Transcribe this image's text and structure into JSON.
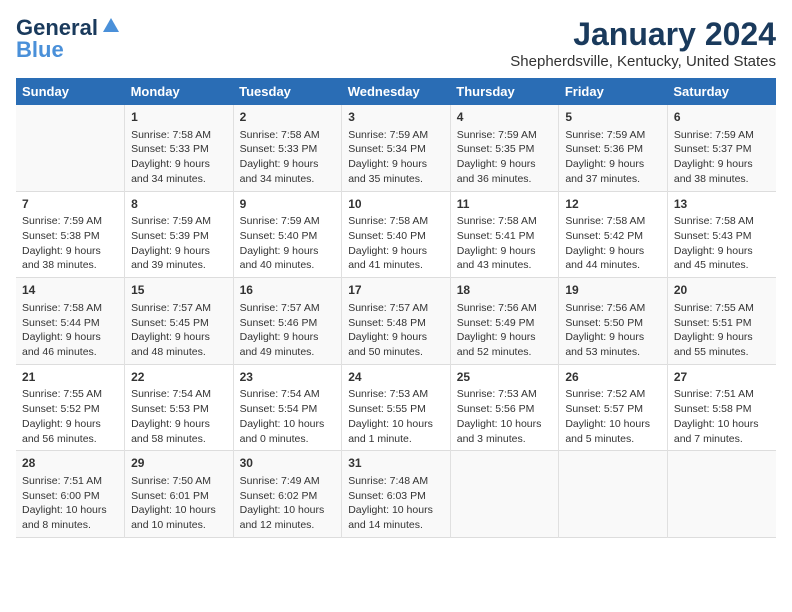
{
  "logo": {
    "line1": "General",
    "line2": "Blue"
  },
  "title": "January 2024",
  "location": "Shepherdsville, Kentucky, United States",
  "days_header": [
    "Sunday",
    "Monday",
    "Tuesday",
    "Wednesday",
    "Thursday",
    "Friday",
    "Saturday"
  ],
  "weeks": [
    [
      {
        "day": "",
        "text": ""
      },
      {
        "day": "1",
        "text": "Sunrise: 7:58 AM\nSunset: 5:33 PM\nDaylight: 9 hours\nand 34 minutes."
      },
      {
        "day": "2",
        "text": "Sunrise: 7:58 AM\nSunset: 5:33 PM\nDaylight: 9 hours\nand 34 minutes."
      },
      {
        "day": "3",
        "text": "Sunrise: 7:59 AM\nSunset: 5:34 PM\nDaylight: 9 hours\nand 35 minutes."
      },
      {
        "day": "4",
        "text": "Sunrise: 7:59 AM\nSunset: 5:35 PM\nDaylight: 9 hours\nand 36 minutes."
      },
      {
        "day": "5",
        "text": "Sunrise: 7:59 AM\nSunset: 5:36 PM\nDaylight: 9 hours\nand 37 minutes."
      },
      {
        "day": "6",
        "text": "Sunrise: 7:59 AM\nSunset: 5:37 PM\nDaylight: 9 hours\nand 38 minutes."
      }
    ],
    [
      {
        "day": "7",
        "text": "Sunrise: 7:59 AM\nSunset: 5:38 PM\nDaylight: 9 hours\nand 38 minutes."
      },
      {
        "day": "8",
        "text": "Sunrise: 7:59 AM\nSunset: 5:39 PM\nDaylight: 9 hours\nand 39 minutes."
      },
      {
        "day": "9",
        "text": "Sunrise: 7:59 AM\nSunset: 5:40 PM\nDaylight: 9 hours\nand 40 minutes."
      },
      {
        "day": "10",
        "text": "Sunrise: 7:58 AM\nSunset: 5:40 PM\nDaylight: 9 hours\nand 41 minutes."
      },
      {
        "day": "11",
        "text": "Sunrise: 7:58 AM\nSunset: 5:41 PM\nDaylight: 9 hours\nand 43 minutes."
      },
      {
        "day": "12",
        "text": "Sunrise: 7:58 AM\nSunset: 5:42 PM\nDaylight: 9 hours\nand 44 minutes."
      },
      {
        "day": "13",
        "text": "Sunrise: 7:58 AM\nSunset: 5:43 PM\nDaylight: 9 hours\nand 45 minutes."
      }
    ],
    [
      {
        "day": "14",
        "text": "Sunrise: 7:58 AM\nSunset: 5:44 PM\nDaylight: 9 hours\nand 46 minutes."
      },
      {
        "day": "15",
        "text": "Sunrise: 7:57 AM\nSunset: 5:45 PM\nDaylight: 9 hours\nand 48 minutes."
      },
      {
        "day": "16",
        "text": "Sunrise: 7:57 AM\nSunset: 5:46 PM\nDaylight: 9 hours\nand 49 minutes."
      },
      {
        "day": "17",
        "text": "Sunrise: 7:57 AM\nSunset: 5:48 PM\nDaylight: 9 hours\nand 50 minutes."
      },
      {
        "day": "18",
        "text": "Sunrise: 7:56 AM\nSunset: 5:49 PM\nDaylight: 9 hours\nand 52 minutes."
      },
      {
        "day": "19",
        "text": "Sunrise: 7:56 AM\nSunset: 5:50 PM\nDaylight: 9 hours\nand 53 minutes."
      },
      {
        "day": "20",
        "text": "Sunrise: 7:55 AM\nSunset: 5:51 PM\nDaylight: 9 hours\nand 55 minutes."
      }
    ],
    [
      {
        "day": "21",
        "text": "Sunrise: 7:55 AM\nSunset: 5:52 PM\nDaylight: 9 hours\nand 56 minutes."
      },
      {
        "day": "22",
        "text": "Sunrise: 7:54 AM\nSunset: 5:53 PM\nDaylight: 9 hours\nand 58 minutes."
      },
      {
        "day": "23",
        "text": "Sunrise: 7:54 AM\nSunset: 5:54 PM\nDaylight: 10 hours\nand 0 minutes."
      },
      {
        "day": "24",
        "text": "Sunrise: 7:53 AM\nSunset: 5:55 PM\nDaylight: 10 hours\nand 1 minute."
      },
      {
        "day": "25",
        "text": "Sunrise: 7:53 AM\nSunset: 5:56 PM\nDaylight: 10 hours\nand 3 minutes."
      },
      {
        "day": "26",
        "text": "Sunrise: 7:52 AM\nSunset: 5:57 PM\nDaylight: 10 hours\nand 5 minutes."
      },
      {
        "day": "27",
        "text": "Sunrise: 7:51 AM\nSunset: 5:58 PM\nDaylight: 10 hours\nand 7 minutes."
      }
    ],
    [
      {
        "day": "28",
        "text": "Sunrise: 7:51 AM\nSunset: 6:00 PM\nDaylight: 10 hours\nand 8 minutes."
      },
      {
        "day": "29",
        "text": "Sunrise: 7:50 AM\nSunset: 6:01 PM\nDaylight: 10 hours\nand 10 minutes."
      },
      {
        "day": "30",
        "text": "Sunrise: 7:49 AM\nSunset: 6:02 PM\nDaylight: 10 hours\nand 12 minutes."
      },
      {
        "day": "31",
        "text": "Sunrise: 7:48 AM\nSunset: 6:03 PM\nDaylight: 10 hours\nand 14 minutes."
      },
      {
        "day": "",
        "text": ""
      },
      {
        "day": "",
        "text": ""
      },
      {
        "day": "",
        "text": ""
      }
    ]
  ]
}
